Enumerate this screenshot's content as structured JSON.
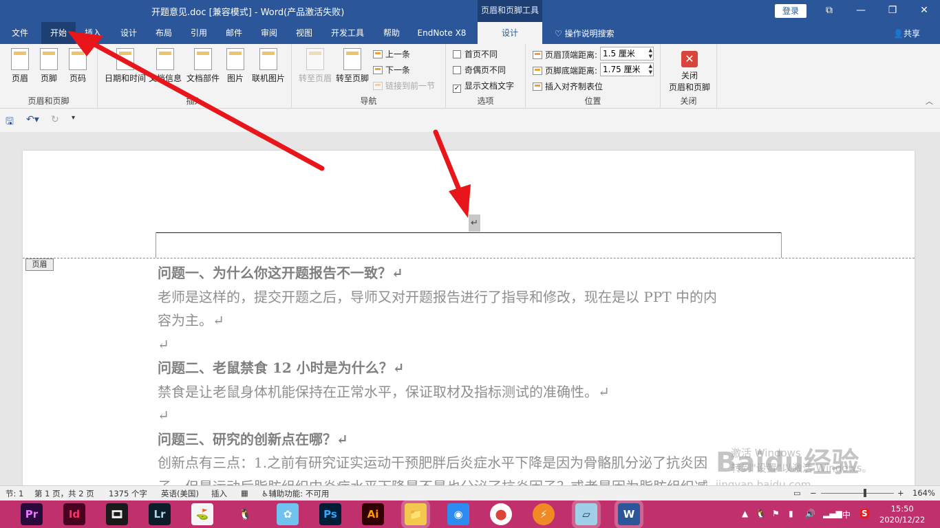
{
  "window": {
    "title": "开题意见.doc [兼容模式]  -  Word(产品激活失败)",
    "context_tab_title": "页眉和页脚工具",
    "login": "登录",
    "controls": [
      "⧉",
      "—",
      "❐",
      "✕"
    ]
  },
  "menu": {
    "tabs": [
      "文件",
      "开始",
      "插入",
      "设计",
      "布局",
      "引用",
      "邮件",
      "审阅",
      "视图",
      "开发工具",
      "帮助",
      "EndNote X8",
      "设计"
    ],
    "active_tab": "设计",
    "tell_me": "操作说明搜索",
    "share": "共享"
  },
  "ribbon": {
    "header_footer_group": {
      "label": "页眉和页脚",
      "buttons": [
        "页眉",
        "页脚",
        "页码"
      ]
    },
    "insert_group": {
      "label": "插入",
      "buttons": [
        "日期和时间",
        "文档信息",
        "文档部件",
        "图片",
        "联机图片"
      ]
    },
    "nav_group": {
      "label": "导航",
      "goto_header": "转至页眉",
      "goto_footer": "转至页脚",
      "prev": "上一条",
      "next": "下一条",
      "link_prev": "链接到前一节"
    },
    "options_group": {
      "label": "选项",
      "different_first": "首页不同",
      "different_odd_even": "奇偶页不同",
      "show_doc_text": "显示文档文字"
    },
    "position_group": {
      "label": "位置",
      "header_top_label": "页眉顶端距离:",
      "header_top_value": "1.5 厘米",
      "footer_bottom_label": "页脚底端距离:",
      "footer_bottom_value": "1.75 厘米",
      "insert_align_tab": "插入对齐制表位"
    },
    "close_group": {
      "label": "关闭",
      "close_btn_line1": "关闭",
      "close_btn_line2": "页眉和页脚"
    }
  },
  "document": {
    "header_tag": "页眉",
    "return_mark": "↵",
    "lines": [
      {
        "text": "问题一、为什么你这开题报告不一致？↵",
        "bold": true
      },
      {
        "text": "老师是这样的，提交开题之后，导师又对开题报告进行了指导和修改，现在是以 PPT 中的内",
        "bold": false
      },
      {
        "text": "容为主。↵",
        "bold": false
      },
      {
        "text": "↵",
        "bold": false
      },
      {
        "text": "问题二、老鼠禁食 12 小时是为什么？↵",
        "bold": true
      },
      {
        "text": "禁食是让老鼠身体机能保持在正常水平，保证取材及指标测试的准确性。↵",
        "bold": false
      },
      {
        "text": "↵",
        "bold": false
      },
      {
        "text": "问题三、研究的创新点在哪？↵",
        "bold": true
      },
      {
        "text": "创新点有三点：1.之前有研究证实运动干预肥胖后炎症水平下降是因为骨骼肌分泌了抗炎因",
        "bold": false
      },
      {
        "text": "子，但是运动后脂肪组织中炎症水平下降是不是也分泌了抗炎因子？或者是因为脂肪组织减",
        "bold": false
      }
    ]
  },
  "watermark": {
    "brand": "Baidu经验",
    "activate_line1": "激活 Windows",
    "activate_line2": "转到\"设置\"以激活 Windows。",
    "url": "jingyan.baidu.com"
  },
  "status": {
    "section": "节: 1",
    "page": "第 1 页，共 2 页",
    "words": "1375 个字",
    "language": "英语(美国)",
    "mode": "插入",
    "accessibility": "辅助功能: 不可用",
    "zoom": "164%"
  },
  "taskbar": {
    "apps": [
      "Pr",
      "Id",
      "🎞",
      "Lr",
      "⛳",
      "🐧",
      "✿",
      "Ps",
      "Ai",
      "📁",
      "◉",
      "⬤",
      "⚡",
      "▱",
      "W"
    ],
    "ime": "中",
    "time": "15:50",
    "date": "2020/12/22"
  },
  "colors": {
    "word_blue": "#2b579a",
    "taskbar": "#c0306d",
    "arrow_red": "#e8151b"
  }
}
